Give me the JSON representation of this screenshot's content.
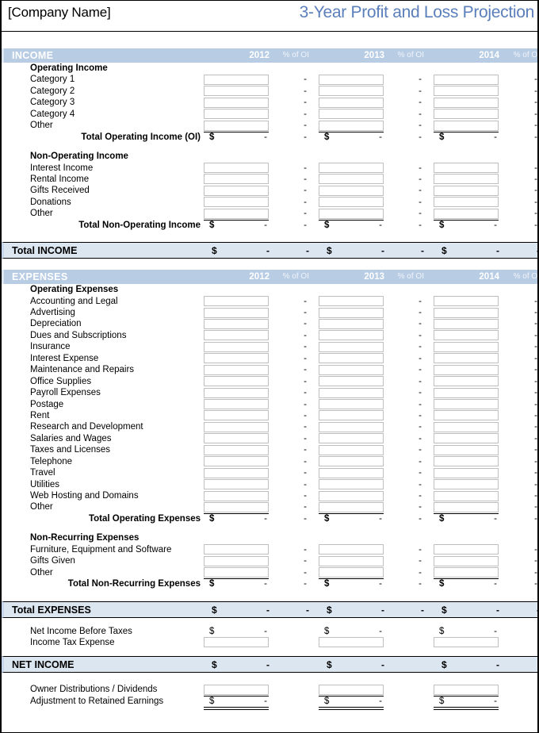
{
  "meta": {
    "company": "[Company Name]",
    "doc_title": "3-Year Profit and Loss Projection",
    "accent_blue": "#5b7fba",
    "band_blue": "#b8cce4",
    "total_blue": "#dce6f1",
    "dash": "-",
    "dollar": "$"
  },
  "columns": {
    "years": [
      "2012",
      "2013",
      "2014"
    ],
    "pct_header": "% of OI"
  },
  "sections": [
    {
      "band": "INCOME",
      "groups": [
        {
          "heading": "Operating Income",
          "items": [
            "Category 1",
            "Category 2",
            "Category 3",
            "Category 4",
            "Other"
          ],
          "total_label": "Total Operating Income (OI)"
        },
        {
          "heading": "Non-Operating Income",
          "items": [
            "Interest Income",
            "Rental Income",
            "Gifts Received",
            "Donations",
            "Other"
          ],
          "total_label": "Total Non-Operating Income"
        }
      ],
      "total": {
        "label": "Total INCOME",
        "show_pct": true
      }
    },
    {
      "band": "EXPENSES",
      "groups": [
        {
          "heading": "Operating Expenses",
          "items": [
            "Accounting and Legal",
            "Advertising",
            "Depreciation",
            "Dues and Subscriptions",
            "Insurance",
            "Interest Expense",
            "Maintenance and Repairs",
            "Office Supplies",
            "Payroll Expenses",
            "Postage",
            "Rent",
            "Research and Development",
            "Salaries and Wages",
            "Taxes and Licenses",
            "Telephone",
            "Travel",
            "Utilities",
            "Web Hosting and Domains",
            "Other"
          ],
          "total_label": "Total Operating Expenses"
        },
        {
          "heading": "Non-Recurring Expenses",
          "items": [
            "Furniture, Equipment and Software",
            "Gifts Given",
            "Other"
          ],
          "total_label": "Total Non-Recurring Expenses"
        }
      ],
      "total": {
        "label": "Total EXPENSES",
        "show_pct": true
      }
    }
  ],
  "tax_block": {
    "net_before_taxes": "Net Income Before Taxes",
    "income_tax_expense": "Income Tax Expense"
  },
  "net_income": {
    "label": "NET INCOME",
    "show_pct": false
  },
  "footer_block": {
    "owner_distributions": "Owner Distributions / Dividends",
    "retained_earnings": "Adjustment to Retained Earnings"
  }
}
